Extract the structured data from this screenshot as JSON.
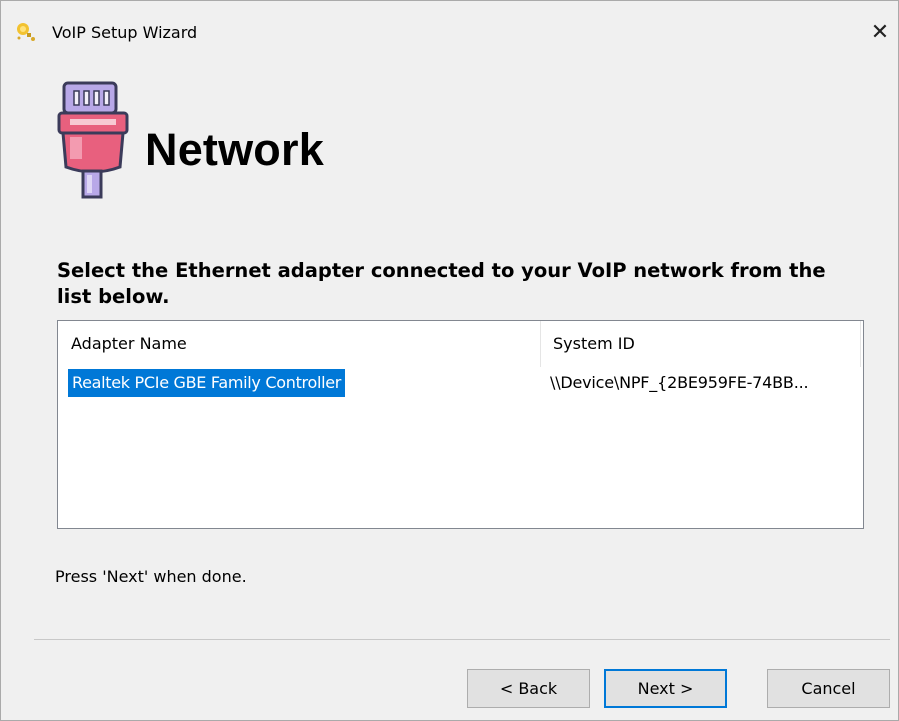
{
  "window": {
    "title": "VoIP Setup Wizard",
    "close_glyph": "✕"
  },
  "header": {
    "title": "Network",
    "icon": "ethernet-plug-icon"
  },
  "instruction": "Select the Ethernet adapter connected to your VoIP network from the list below.",
  "adapter_list": {
    "columns": [
      "Adapter Name",
      "System ID"
    ],
    "rows": [
      {
        "adapter_name": "Realtek PCIe GBE Family Controller",
        "system_id": "\\\\Device\\NPF_{2BE959FE-74BB...",
        "selected": true
      }
    ]
  },
  "hint": "Press 'Next' when done.",
  "buttons": {
    "back": "< Back",
    "next": "Next >",
    "cancel": "Cancel"
  },
  "colors": {
    "selection": "#0078d7",
    "default_button_border": "#0078d7",
    "plug_pink": "#e8607e",
    "plug_lilac": "#b8a8e8"
  }
}
